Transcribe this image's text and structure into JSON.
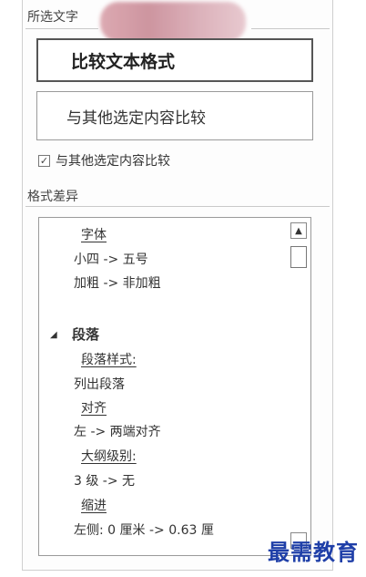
{
  "selected_text": {
    "label": "所选文字",
    "compare_format_button": "比较文本格式",
    "compare_with_other_button": "与其他选定内容比较",
    "checkbox_label": "与其他选定内容比较",
    "checkbox_checked": true
  },
  "format_diff": {
    "label": "格式差异",
    "items": [
      {
        "text": "字体",
        "kind": "head"
      },
      {
        "text": "小四  ->  五号",
        "kind": "value"
      },
      {
        "text": "加粗  ->  非加粗",
        "kind": "value"
      },
      {
        "text": "段落",
        "kind": "section"
      },
      {
        "text": "段落样式:",
        "kind": "head"
      },
      {
        "text": "列出段落",
        "kind": "value"
      },
      {
        "text": "对齐",
        "kind": "head"
      },
      {
        "text": "左  ->  两端对齐",
        "kind": "value"
      },
      {
        "text": "大纲级别:",
        "kind": "head"
      },
      {
        "text": "3 级  ->  无",
        "kind": "value"
      },
      {
        "text": "缩进",
        "kind": "head"
      },
      {
        "text": "左侧:  0 厘米  ->   0.63 厘",
        "kind": "value"
      }
    ]
  },
  "scrollbar": {
    "up_icon": "triangle-up",
    "down_icon": "triangle-down"
  },
  "watermark": "最需教育",
  "colors": {
    "watermark": "#1f3fa8",
    "border": "#9a9a9a"
  }
}
